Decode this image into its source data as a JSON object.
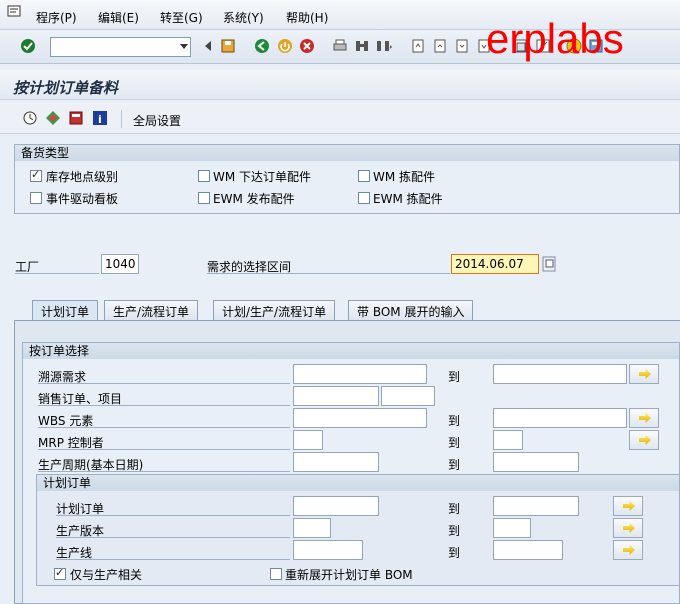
{
  "menu": [
    "程序(P)",
    "编辑(E)",
    "转至(G)",
    "系统(Y)",
    "帮助(H)"
  ],
  "watermark": "erplabs",
  "title": "按计划订单备料",
  "app_toolbar": {
    "global_settings": "全局设置"
  },
  "prep_type": {
    "title": "备货类型",
    "options": [
      {
        "label": "库存地点级别",
        "checked": true
      },
      {
        "label": "WM 下达订单配件",
        "checked": false
      },
      {
        "label": "WM 拣配件",
        "checked": false
      },
      {
        "label": "事件驱动看板",
        "checked": false
      },
      {
        "label": "EWM 发布配件",
        "checked": false
      },
      {
        "label": "EWM 拣配件",
        "checked": false
      }
    ]
  },
  "plant": {
    "label": "工厂",
    "value": "1040"
  },
  "req_range": {
    "label": "需求的选择区间",
    "value": "2014.06.07"
  },
  "tabs": [
    "计划订单",
    "生产/流程订单",
    "计划/生产/流程订单",
    "带 BOM 展开的输入"
  ],
  "order_selection": {
    "title": "按订单选择",
    "to_label": "到",
    "rows": [
      "溯源需求",
      "销售订单、项目",
      "WBS 元素",
      "MRP 控制者",
      "生产周期(基本日期)"
    ]
  },
  "planned_order": {
    "title": "计划订单",
    "to_label": "到",
    "rows": [
      "计划订单",
      "生产版本",
      "生产线"
    ],
    "only_prod_relevant": {
      "label": "仅与生产相关",
      "checked": true
    },
    "re_explode_bom": {
      "label": "重新展开计划订单 BOM",
      "checked": false
    }
  }
}
